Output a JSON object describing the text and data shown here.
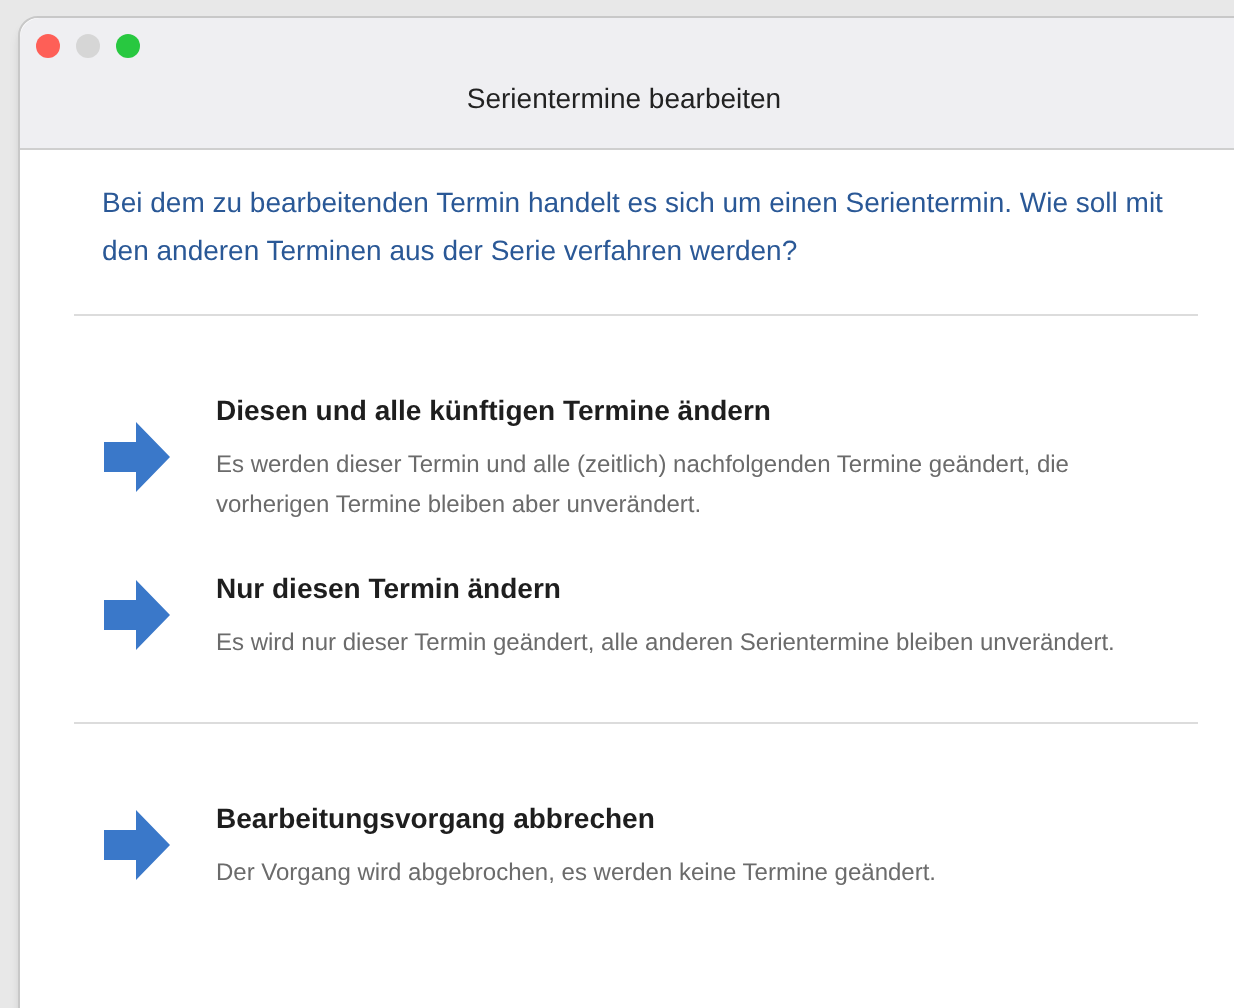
{
  "window": {
    "title": "Serientermine bearbeiten"
  },
  "intro": "Bei dem zu bearbeitenden Termin handelt es sich um einen Serientermin. Wie soll mit den anderen Terminen aus der Serie verfahren werden?",
  "option_groups": [
    {
      "options": [
        {
          "title": "Diesen und alle künftigen Termine ändern",
          "description": "Es werden dieser Termin und alle (zeitlich) nachfolgenden Termine geändert, die vorherigen Termine bleiben aber unverändert."
        },
        {
          "title": "Nur diesen Termin ändern",
          "description": "Es wird nur dieser Termin geändert, alle anderen Serientermine bleiben unverändert."
        }
      ]
    },
    {
      "options": [
        {
          "title": "Bearbeitungsvorgang abbrechen",
          "description": "Der Vorgang wird abgebrochen, es werden keine Termine geändert."
        }
      ]
    }
  ]
}
